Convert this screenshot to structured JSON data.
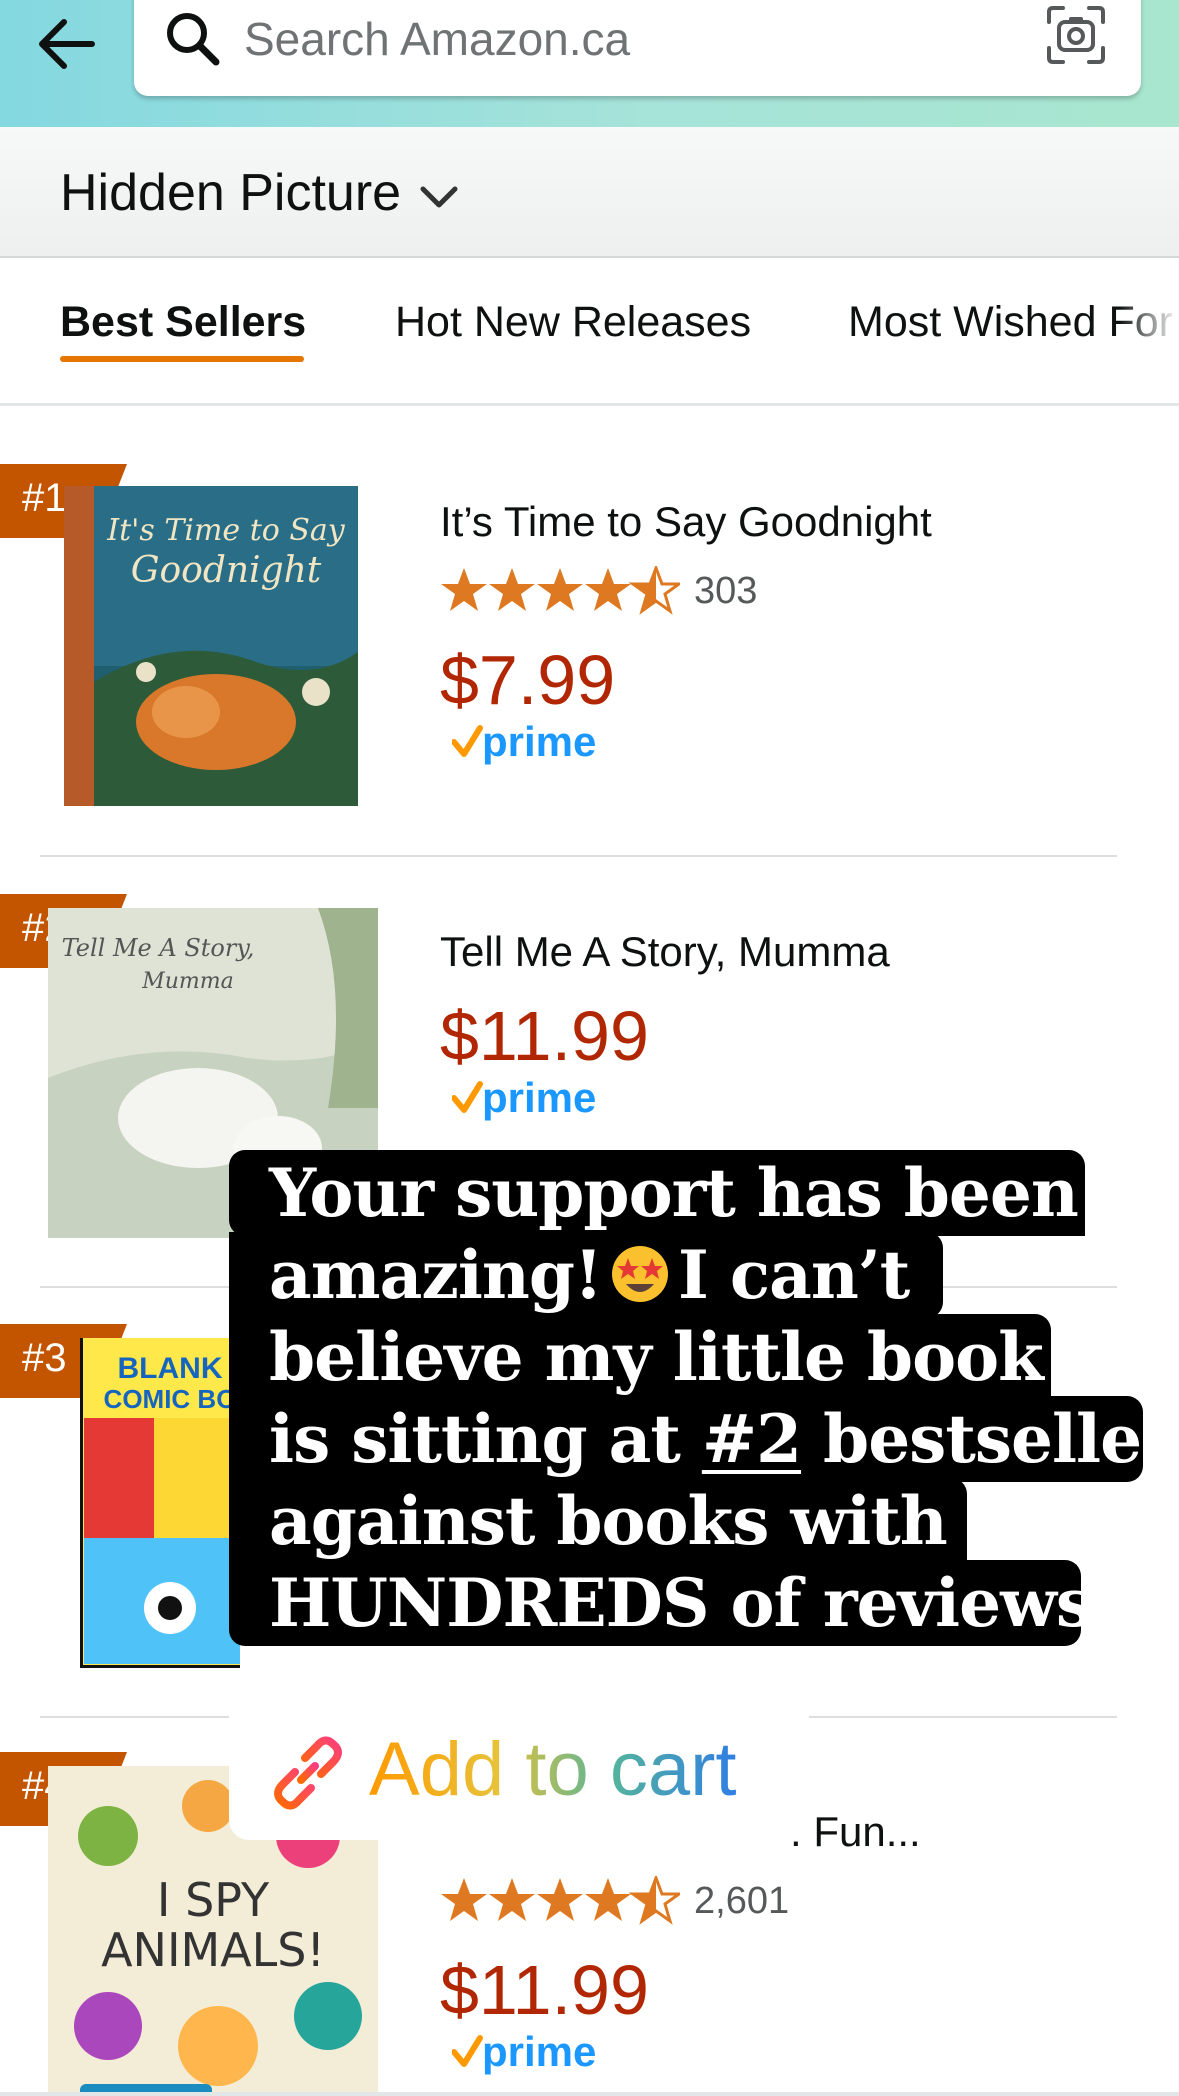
{
  "header": {
    "search_placeholder": "Search Amazon.ca"
  },
  "category": {
    "title": "Hidden Picture"
  },
  "tabs": [
    {
      "label": "Best Sellers",
      "active": true
    },
    {
      "label": "Hot New Releases",
      "active": false
    },
    {
      "label": "Most Wished For",
      "active": false
    }
  ],
  "products": [
    {
      "rank": "#1",
      "title": "It’s Time to Say Goodnight",
      "rating": 4.5,
      "reviews": "303",
      "price": "$7.99",
      "prime": true,
      "cover_text": "It's Time to Say Goodnight"
    },
    {
      "rank": "#2",
      "title": "Tell Me A Story, Mumma",
      "price": "$11.99",
      "prime": true,
      "cover_text": "Tell Me A Story, Mumma"
    },
    {
      "rank": "#3",
      "cover_text": "BLANK COMIC BOOK"
    },
    {
      "rank": "#4",
      "title_fragment": ". Fun...",
      "rating": 4.5,
      "reviews": "2,601",
      "price": "$11.99",
      "prime": true,
      "cover_text": "I SPY ANIMALS!"
    }
  ],
  "caption": {
    "line1": "Your support has been",
    "line2_a": "amazing!",
    "line2_b": "I can’t",
    "line3": "believe my little book",
    "line4_a": "is sitting at ",
    "line4_u": "#2",
    "line4_b": " bestseller",
    "line5": "against books with",
    "line6": "HUNDREDS of reviews!"
  },
  "sticker": {
    "label": "Add to cart"
  },
  "colors": {
    "accent": "#e77600",
    "price": "#b12704",
    "rank_badge": "#c45500",
    "star": "#de7921",
    "prime_blue": "#1a98ff"
  }
}
